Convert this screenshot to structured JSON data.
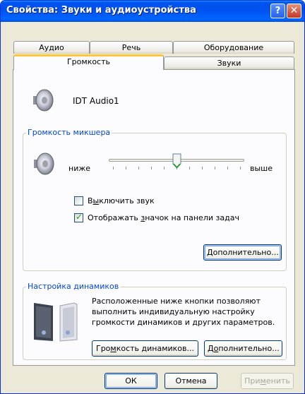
{
  "window": {
    "title": "Свойства: Звуки и аудиоустройства",
    "help_glyph": "?",
    "close_glyph": "✕"
  },
  "tabs": {
    "row_back": [
      "Аудио",
      "Речь",
      "Оборудование"
    ],
    "row_front": [
      "Громкость",
      "Звуки"
    ],
    "active": "Громкость"
  },
  "device": {
    "icon": "speaker-icon",
    "name": "IDT Audio1"
  },
  "mixer": {
    "group_label": "Громкость микшера",
    "icon": "speaker-icon",
    "low_label": "ниже",
    "high_label": "выше",
    "volume_level": 0.5,
    "mute": {
      "label_pre": "В",
      "label_key": "ы",
      "label_post": "ключить звук",
      "checked": false
    },
    "tray": {
      "label_pre": "Отображать ",
      "label_key": "з",
      "label_post": "начок на панели задач",
      "checked": true
    },
    "advanced_button": {
      "key": "Д",
      "rest": "ополнительно..."
    }
  },
  "speakers": {
    "group_label": "Настройка динамиков",
    "icon": "speakers-icon",
    "description": [
      "Расположенные ниже кнопки позволяют",
      "выполнить индивидуальную настройку",
      "громкости динамиков и других параметров."
    ],
    "volume_button": {
      "pre": "Гро",
      "key": "м",
      "post": "кость динамиков..."
    },
    "advanced_button": {
      "pre": "Д",
      "key": "о",
      "post": "полнительно..."
    }
  },
  "footer": {
    "ok": "ОК",
    "cancel": "Отмена",
    "apply": {
      "pre": "При",
      "key": "м",
      "post": "енить"
    }
  }
}
